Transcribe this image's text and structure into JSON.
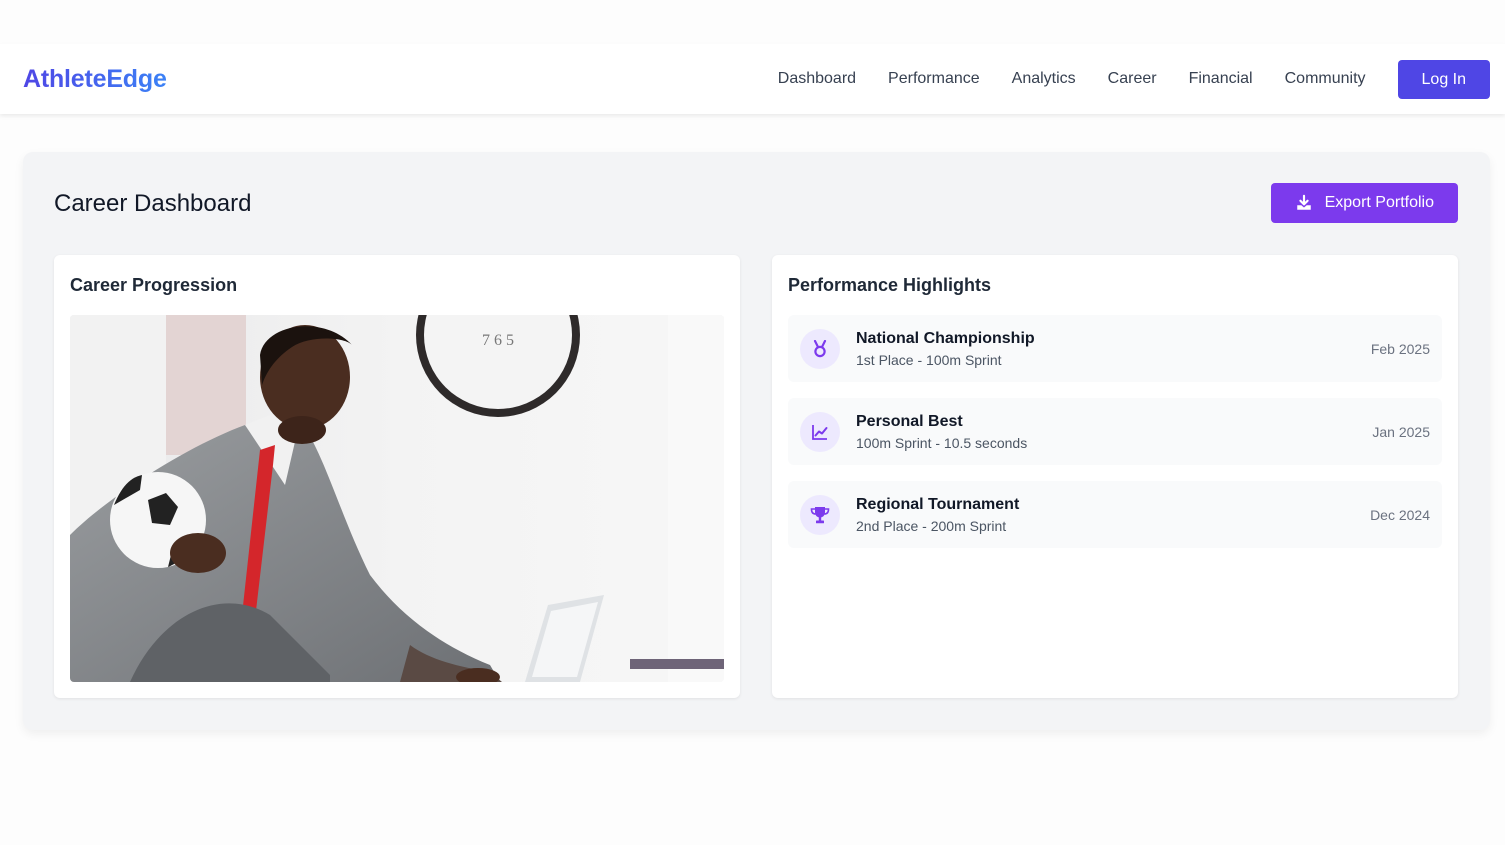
{
  "brand": {
    "name": "AthleteEdge"
  },
  "nav": {
    "links": [
      "Dashboard",
      "Performance",
      "Analytics",
      "Career",
      "Financial",
      "Community"
    ],
    "login_label": "Log In"
  },
  "page": {
    "title": "Career Dashboard",
    "export_label": "Export Portfolio"
  },
  "career": {
    "title": "Career Progression"
  },
  "highlights": {
    "title": "Performance Highlights",
    "items": [
      {
        "icon": "medal-icon",
        "title": "National Championship",
        "subtitle": "1st Place - 100m Sprint",
        "date": "Feb 2025"
      },
      {
        "icon": "chart-line-icon",
        "title": "Personal Best",
        "subtitle": "100m Sprint - 10.5 seconds",
        "date": "Jan 2025"
      },
      {
        "icon": "trophy-icon",
        "title": "Regional Tournament",
        "subtitle": "2nd Place - 200m Sprint",
        "date": "Dec 2024"
      }
    ]
  },
  "colors": {
    "brand_start": "#4f46e5",
    "brand_end": "#3b82f6",
    "accent": "#7c3aed",
    "icon_bg": "#ede9fe"
  }
}
